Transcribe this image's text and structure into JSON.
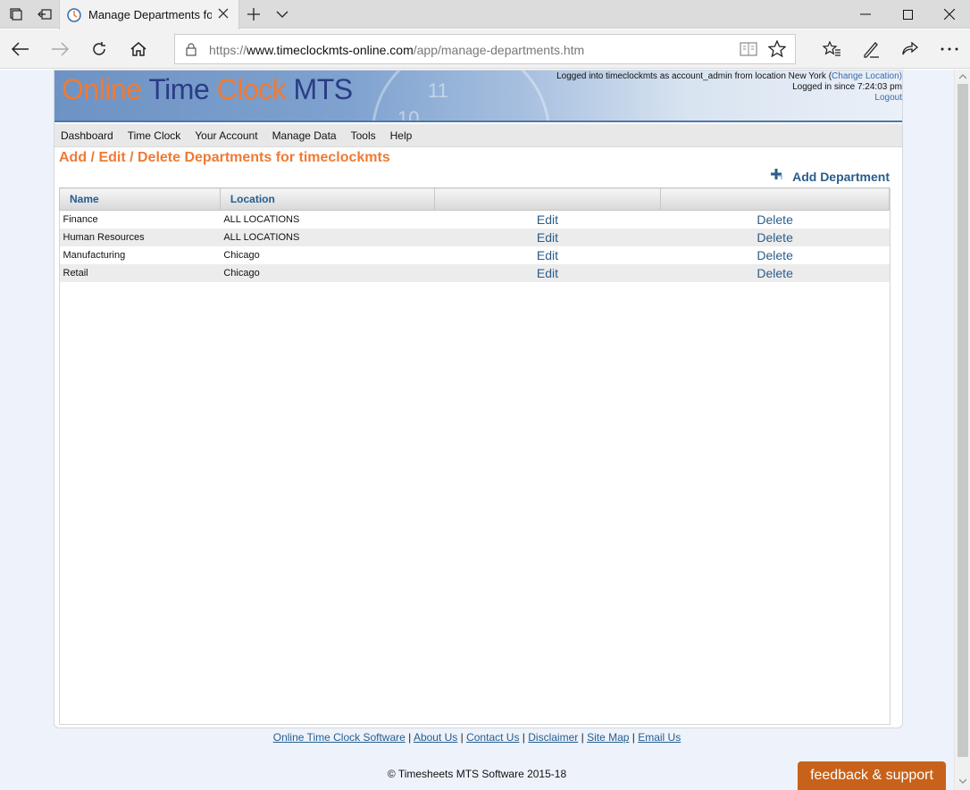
{
  "browser": {
    "tab_title": "Manage Departments fo",
    "url_prefix": "https://",
    "url_domain": "www.timeclockmts-online.com",
    "url_path": "/app/manage-departments.htm"
  },
  "header": {
    "logo_word1": "Online",
    "logo_word2": "Time",
    "logo_word3": "Clock",
    "logo_word4": "MTS",
    "clock_num_11": "11",
    "clock_num_10": "10",
    "login_line1": "Logged into timeclockmts as account_admin from location New York (",
    "change_location": "Change Location",
    "login_line1_end": ")",
    "login_line2": "Logged in since 7:24:03 pm",
    "logout": "Logout"
  },
  "menu": {
    "items": [
      "Dashboard",
      "Time Clock",
      "Your Account",
      "Manage Data",
      "Tools",
      "Help"
    ]
  },
  "main": {
    "title": "Add / Edit / Delete Departments for timeclockmts",
    "add_department": "Add Department",
    "columns": [
      "Name",
      "Location",
      "",
      ""
    ],
    "rows": [
      {
        "name": "Finance",
        "location": "ALL LOCATIONS",
        "edit": "Edit",
        "delete": "Delete"
      },
      {
        "name": "Human Resources",
        "location": "ALL LOCATIONS",
        "edit": "Edit",
        "delete": "Delete"
      },
      {
        "name": "Manufacturing",
        "location": "Chicago",
        "edit": "Edit",
        "delete": "Delete"
      },
      {
        "name": "Retail",
        "location": "Chicago",
        "edit": "Edit",
        "delete": "Delete"
      }
    ]
  },
  "footer": {
    "links": [
      "Online Time Clock Software",
      "About Us",
      "Contact Us",
      "Disclaimer",
      "Site Map",
      "Email Us"
    ],
    "separator": " | ",
    "copyright": "© Timesheets MTS Software 2015-18",
    "feedback": "feedback & support"
  },
  "colors": {
    "accent_orange": "#f07a33",
    "link_blue": "#2a5d8a",
    "logo_navy": "#2a3c86"
  }
}
